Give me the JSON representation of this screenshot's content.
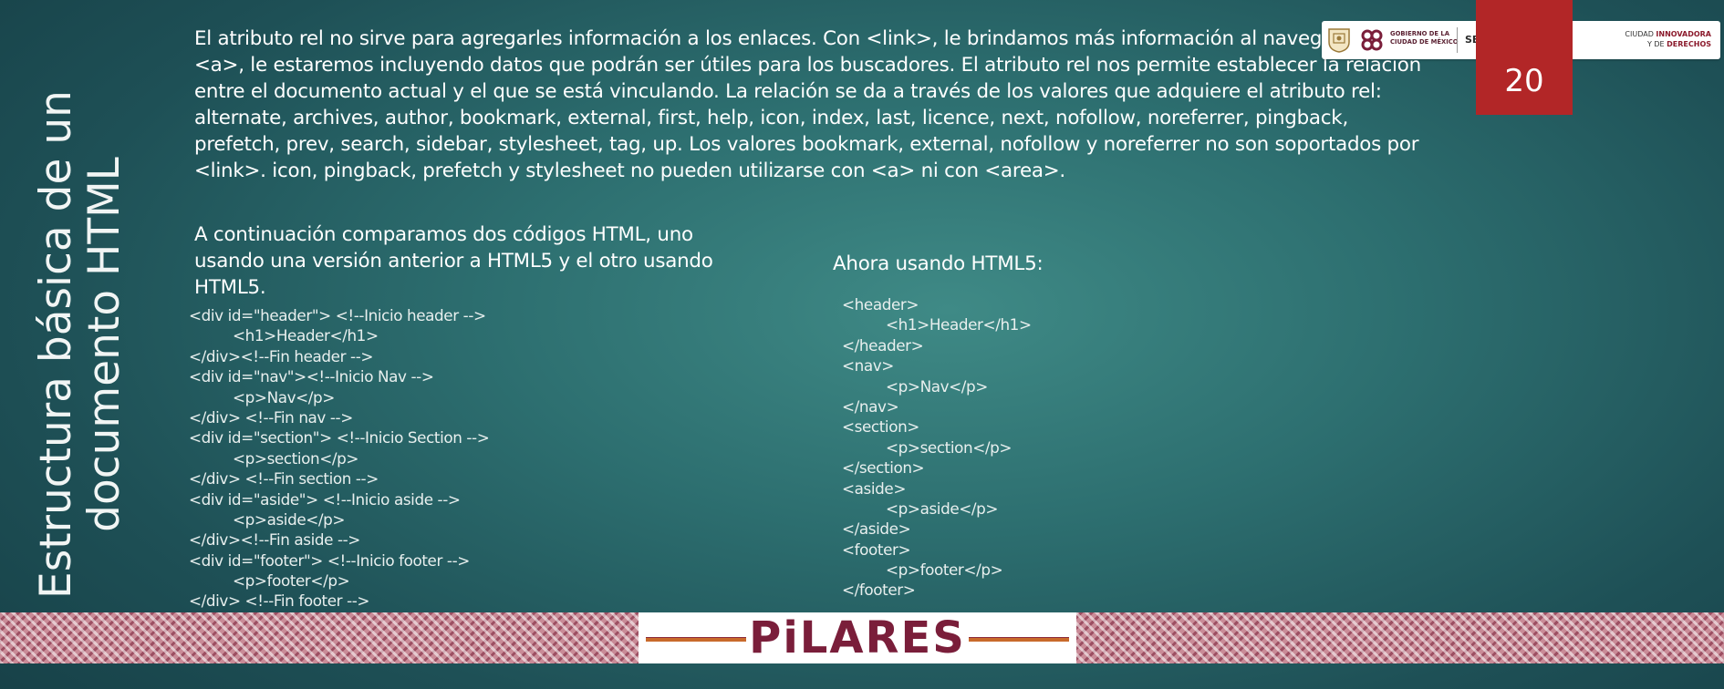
{
  "slide": {
    "title_lines": [
      "Estructura básica de un",
      "documento HTML"
    ],
    "page_number": "20",
    "paragraph": "El atributo rel no sirve para agregarles información a los enlaces. Con <link>, le brindamos más información al navegador, con <a>, le estaremos incluyendo datos que podrán ser útiles para los buscadores. El atributo rel nos permite establecer la relación entre el documento actual y el que se está vinculando. La relación se da a través de los valores que adquiere el atributo rel: alternate, archives, author, bookmark, external, first, help, icon, index, last, licence, next, nofollow, noreferrer, pingback, prefetch, prev, search, sidebar, stylesheet, tag, up. Los valores bookmark, external, nofollow y noreferrer no son soportados por <link>. icon, pingback, prefetch y stylesheet no pueden utilizarse con <a> ni con <area>.",
    "compare_text": "A continuación comparamos dos códigos HTML, uno usando una versión anterior a HTML5 y el otro usando HTML5.",
    "html5_heading": "Ahora usando HTML5:",
    "code_old": [
      {
        "text": "<div id=\"header\"> <!--Inicio header -->",
        "indent": false
      },
      {
        "text": "<h1>Header</h1>",
        "indent": true
      },
      {
        "text": "</div><!--Fin header -->",
        "indent": false
      },
      {
        "text": "<div id=\"nav\"><!--Inicio Nav -->",
        "indent": false
      },
      {
        "text": "<p>Nav</p>",
        "indent": true
      },
      {
        "text": "</div> <!--Fin nav -->",
        "indent": false
      },
      {
        "text": "<div id=\"section\"> <!--Inicio Section -->",
        "indent": false
      },
      {
        "text": "<p>section</p>",
        "indent": true
      },
      {
        "text": "</div> <!--Fin section -->",
        "indent": false
      },
      {
        "text": "<div id=\"aside\"> <!--Inicio aside -->",
        "indent": false
      },
      {
        "text": "<p>aside</p>",
        "indent": true
      },
      {
        "text": "</div><!--Fin aside -->",
        "indent": false
      },
      {
        "text": "<div id=\"footer\"> <!--Inicio footer -->",
        "indent": false
      },
      {
        "text": "<p>footer</p>",
        "indent": true
      },
      {
        "text": "</div> <!--Fin footer -->",
        "indent": false
      }
    ],
    "code_html5": [
      {
        "text": "<header>",
        "indent": false
      },
      {
        "text": "<h1>Header</h1>",
        "indent": true
      },
      {
        "text": "</header>",
        "indent": false
      },
      {
        "text": "<nav>",
        "indent": false
      },
      {
        "text": "<p>Nav</p>",
        "indent": true
      },
      {
        "text": "</nav>",
        "indent": false
      },
      {
        "text": "<section>",
        "indent": false
      },
      {
        "text": "<p>section</p>",
        "indent": true
      },
      {
        "text": "</section>",
        "indent": false
      },
      {
        "text": "<aside>",
        "indent": false
      },
      {
        "text": "<p>aside</p>",
        "indent": true
      },
      {
        "text": "</aside>",
        "indent": false
      },
      {
        "text": "<footer>",
        "indent": false
      },
      {
        "text": "<p>footer</p>",
        "indent": true
      },
      {
        "text": "</footer>",
        "indent": false
      }
    ]
  },
  "header_logos": {
    "gov_text": "GOBIERNO DE LA\nCIUDAD DE MÉXICO",
    "sectei": "SECTEI",
    "ciudad_line1": "CIUDAD ",
    "ciudad_line1_bold": "INNOVADORA",
    "ciudad_line2": "Y DE ",
    "ciudad_line2_bold": "DERECHOS"
  },
  "footer": {
    "brand": "PiLARES"
  },
  "colors": {
    "background": "#2d6f70",
    "page_tab": "#b22627",
    "brand": "#7a1e3a",
    "brand_line": "#c96a2b"
  }
}
